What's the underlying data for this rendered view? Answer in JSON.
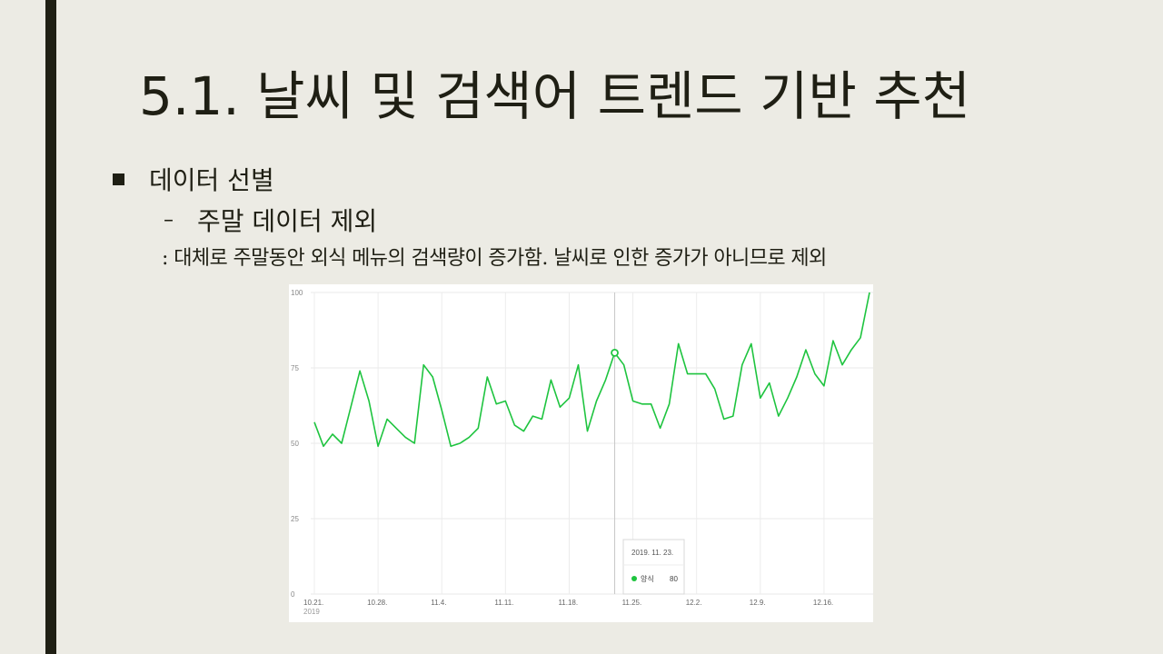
{
  "slide": {
    "title": "5.1.  날씨 및 검색어 트렌드 기반 추천",
    "bullet": "데이터 선별",
    "sub_dash": "–",
    "sub_bullet": "주말 데이터 제외",
    "note": ": 대체로 주말동안 외식 메뉴의 검색량이 증가함. 날씨로 인한 증가가 아니므로 제외"
  },
  "colors": {
    "background": "#ecebe4",
    "text": "#1f1f14",
    "series": "#1ec43f"
  },
  "chart_data": {
    "type": "line",
    "ylim": [
      0,
      100
    ],
    "yticks": [
      "100",
      "75",
      "50",
      "25",
      "0"
    ],
    "xticks": [
      {
        "index": 0,
        "label": "10.21.",
        "sub": "2019"
      },
      {
        "index": 7,
        "label": "10.28."
      },
      {
        "index": 14,
        "label": "11.4."
      },
      {
        "index": 21,
        "label": "11.11."
      },
      {
        "index": 28,
        "label": "11.18."
      },
      {
        "index": 35,
        "label": "11.25."
      },
      {
        "index": 42,
        "label": "12.2."
      },
      {
        "index": 49,
        "label": "12.9."
      },
      {
        "index": 56,
        "label": "12.16."
      }
    ],
    "series": [
      {
        "name": "양식",
        "values": [
          57,
          49,
          53,
          50,
          62,
          74,
          64,
          49,
          58,
          55,
          52,
          50,
          76,
          72,
          61,
          49,
          50,
          52,
          55,
          72,
          63,
          64,
          56,
          54,
          59,
          58,
          71,
          62,
          65,
          76,
          54,
          64,
          71,
          80,
          76,
          64,
          63,
          63,
          55,
          63,
          83,
          73,
          73,
          73,
          68,
          58,
          59,
          76,
          83,
          65,
          70,
          59,
          65,
          72,
          81,
          73,
          69,
          84,
          76,
          81,
          85,
          100
        ]
      }
    ],
    "highlight": {
      "index": 33,
      "date": "2019. 11. 23.",
      "series": "양식",
      "value": "80"
    }
  }
}
